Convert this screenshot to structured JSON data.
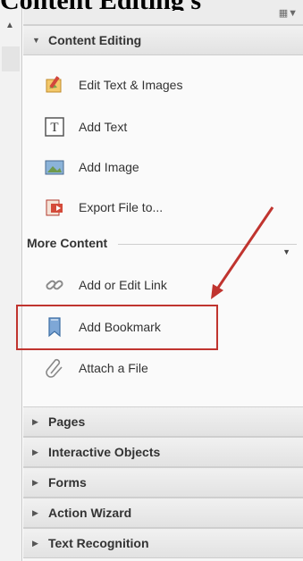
{
  "overlay": {
    "title_text": "Content Editing s"
  },
  "panel": {
    "expanded_section": {
      "label": "Content Editing"
    },
    "tools": [
      {
        "label": "Edit Text & Images",
        "icon": "edit-text-images-icon"
      },
      {
        "label": "Add Text",
        "icon": "add-text-icon"
      },
      {
        "label": "Add Image",
        "icon": "add-image-icon"
      },
      {
        "label": "Export File to...",
        "icon": "export-file-icon"
      }
    ],
    "more_content": {
      "label": "More Content",
      "tools": [
        {
          "label": "Add or Edit Link",
          "icon": "link-icon"
        },
        {
          "label": "Add Bookmark",
          "icon": "bookmark-icon"
        },
        {
          "label": "Attach a File",
          "icon": "paperclip-icon"
        }
      ]
    },
    "collapsed_sections": [
      {
        "label": "Pages"
      },
      {
        "label": "Interactive Objects"
      },
      {
        "label": "Forms"
      },
      {
        "label": "Action Wizard"
      },
      {
        "label": "Text Recognition"
      }
    ]
  },
  "annotation": {
    "highlight_color": "#c0342f"
  }
}
